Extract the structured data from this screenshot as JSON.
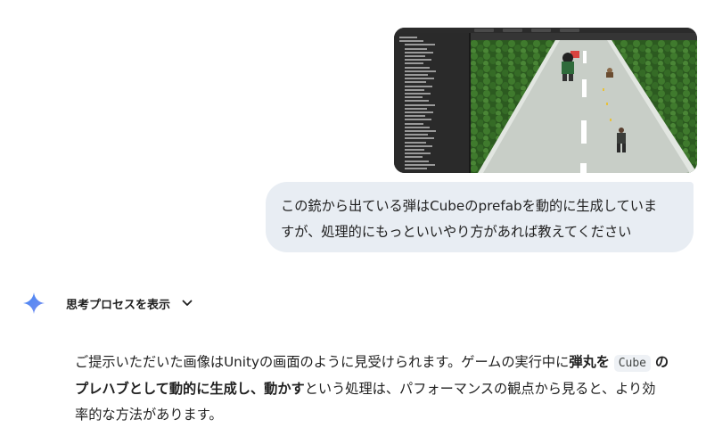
{
  "attachment": {
    "description_icons": [
      "unity-hierarchy-panel",
      "unity-game-view"
    ],
    "colors": {
      "editor_bg": "#1e1e1e",
      "road": "#c9cfc8",
      "forest": "#2f5f22"
    }
  },
  "user_message": {
    "line1": "この銃から出ている弾はCubeのprefabを動的に生成していま",
    "line2": "すが、処理的にもっといいやり方があれば教えてください"
  },
  "thinking": {
    "label": "思考プロセスを表示",
    "icon": "chevron-down-icon"
  },
  "assistant_logo": {
    "icon": "gemini-sparkle-icon",
    "colors": [
      "#4285f4",
      "#9b72cb"
    ]
  },
  "response": {
    "l1_a": "ご提示いただいた画像はUnityの画面のように見受けられます。ゲームの実行中に",
    "l1_b": "弾丸を",
    "l1_code": "Cube",
    "l1_c": "の",
    "l2_a": "プレハブとして動的に生成し、動かす",
    "l2_b": "という処理は、パフォーマンスの観点から見ると、より効",
    "l3": "率的な方法があります。"
  }
}
